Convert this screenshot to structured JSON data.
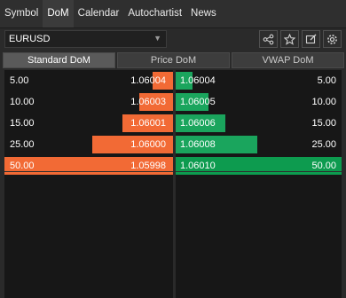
{
  "tabs": [
    {
      "label": "Symbol",
      "active": false
    },
    {
      "label": "DoM",
      "active": true
    },
    {
      "label": "Calendar",
      "active": false
    },
    {
      "label": "Autochartist",
      "active": false
    },
    {
      "label": "News",
      "active": false
    }
  ],
  "symbol": {
    "value": "EURUSD"
  },
  "toolbar": {
    "icons": [
      "share-icon",
      "star-icon",
      "edit-icon",
      "settings-icon"
    ]
  },
  "modes": [
    "Standard DoM",
    "Price DoM",
    "VWAP DoM"
  ],
  "bids": [
    {
      "size": "5.00",
      "price": "1.06004",
      "depth": 0.12
    },
    {
      "size": "10.00",
      "price": "1.06003",
      "depth": 0.2
    },
    {
      "size": "15.00",
      "price": "1.06001",
      "depth": 0.3
    },
    {
      "size": "25.00",
      "price": "1.06000",
      "depth": 0.48
    },
    {
      "size": "50.00",
      "price": "1.05998",
      "depth": 1.0
    }
  ],
  "asks": [
    {
      "size": "5.00",
      "price": "1.06004",
      "depth": 0.1
    },
    {
      "size": "10.00",
      "price": "1.06005",
      "depth": 0.2
    },
    {
      "size": "15.00",
      "price": "1.06006",
      "depth": 0.3
    },
    {
      "size": "25.00",
      "price": "1.06008",
      "depth": 0.49
    },
    {
      "size": "50.00",
      "price": "1.06010",
      "depth": 1.0
    }
  ],
  "colors": {
    "bid": "#f26a35",
    "ask": "#1aa55d",
    "background": "#171717"
  }
}
